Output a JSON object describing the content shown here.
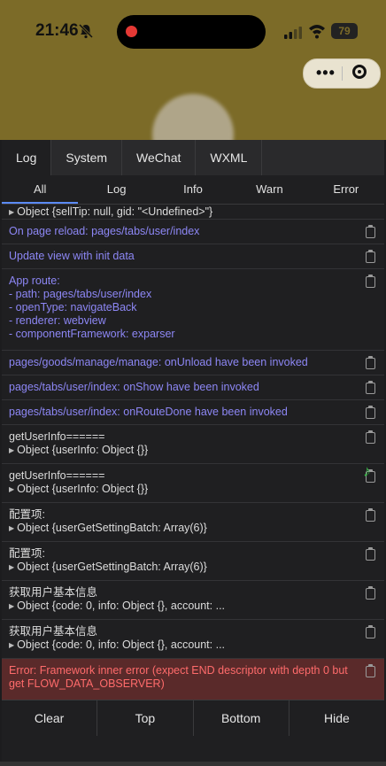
{
  "status_bar": {
    "time": "21:46",
    "battery": "79"
  },
  "console": {
    "main_tabs": [
      "Log",
      "System",
      "WeChat",
      "WXML"
    ],
    "filter_tabs": [
      "All",
      "Log",
      "Info",
      "Warn",
      "Error"
    ],
    "logs": [
      {
        "lines": [
          "Object {sellTip: null, gid: \"<Undefined>\"}"
        ],
        "style": "obj"
      },
      {
        "lines": [
          "On page reload: pages/tabs/user/index"
        ],
        "style": "purple"
      },
      {
        "lines": [
          "Update view with init data"
        ],
        "style": "purple"
      },
      {
        "lines": [
          "App route:",
          "- path: pages/tabs/user/index",
          "- openType: navigateBack",
          "- renderer: webview",
          "- componentFramework: exparser"
        ],
        "style": "purple"
      },
      {
        "lines": [
          "pages/goods/manage/manage: onUnload have been invoked"
        ],
        "style": "purple"
      },
      {
        "lines": [
          "pages/tabs/user/index: onShow have been invoked"
        ],
        "style": "purple"
      },
      {
        "lines": [
          "pages/tabs/user/index: onRouteDone have been invoked"
        ],
        "style": "purple"
      },
      {
        "lines": [
          "getUserInfo======",
          "Object {userInfo: Object {}}"
        ],
        "style": "normal"
      },
      {
        "lines": [
          "getUserInfo======",
          "Object {userInfo: Object {}}"
        ],
        "style": "normal"
      },
      {
        "lines": [
          "配置项:",
          "Object {userGetSettingBatch: Array(6)}"
        ],
        "style": "normal"
      },
      {
        "lines": [
          "配置项:",
          "Object {userGetSettingBatch: Array(6)}"
        ],
        "style": "normal"
      },
      {
        "lines": [
          "获取用户基本信息",
          "Object {code: 0, info: Object {}, account: ..."
        ],
        "style": "normal"
      },
      {
        "lines": [
          "获取用户基本信息",
          "Object {code: 0, info: Object {}, account: ..."
        ],
        "style": "normal"
      },
      {
        "lines": [
          "Error: Framework inner error (expect END descriptor with depth 0 but get FLOW_DATA_OBSERVER)"
        ],
        "style": "error"
      }
    ],
    "bottom_buttons": [
      "Clear",
      "Top",
      "Bottom",
      "Hide"
    ]
  }
}
